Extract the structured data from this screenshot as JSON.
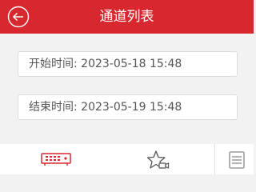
{
  "header": {
    "title": "通道列表",
    "back_icon": "back-circle-arrow-icon",
    "background": "#d7282f"
  },
  "form": {
    "start": {
      "label": "开始时间:",
      "value": "2023-05-18 15:48"
    },
    "end": {
      "label": "结束时间:",
      "value": "2023-05-19 15:48"
    }
  },
  "tabbar": {
    "items": [
      {
        "icon": "device-nvr-icon",
        "active": true,
        "color": "#d7282f"
      },
      {
        "icon": "star-camera-icon",
        "active": false,
        "color": "#555555"
      },
      {
        "icon": "list-icon",
        "active": false,
        "color": "#888888"
      }
    ]
  }
}
